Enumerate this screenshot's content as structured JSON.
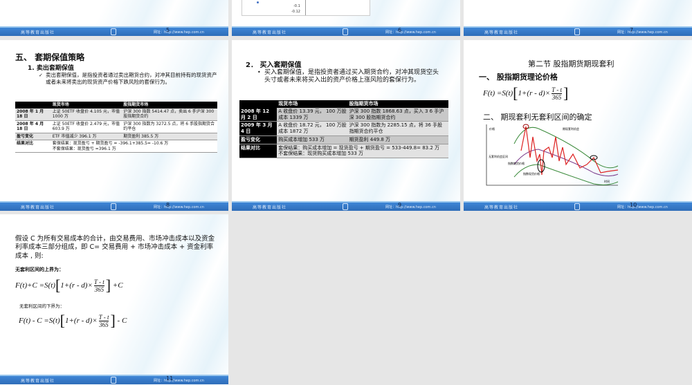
{
  "footer": {
    "publisher": "高等教育出版社",
    "url": "网址：http://www.hep.com.cn"
  },
  "slides": [
    {
      "number": "5"
    },
    {
      "number": "6",
      "chart_ticks": [
        "-0.1",
        "-0.12"
      ]
    },
    {
      "number": "7"
    },
    {
      "number": "8",
      "heading": "五、 套期保值策略",
      "subheading": "1.  卖出套期保值",
      "bullet": "卖出套期保值，是指投资者通过卖出期货合约，对冲其目前持有的现货资产或者未来将卖出的现货资产价格下跌风险的套保行为。",
      "table": {
        "headers": [
          "",
          "现货市场",
          "股指期货市场"
        ],
        "rows": [
          [
            "2008 年 1 月 18 日",
            "上证 50ETF 收盘价 4.105 元，市值 1000 万",
            "沪深 300 指数 5414.47 点，卖出 6 手沪深 300 股指期货合约"
          ],
          [
            "2008 年 4 月 18 日",
            "上证 50ETF 收盘价 2.479 元，市值 603.9 万",
            "沪深 300 指数为 3272.5 点，将 6 手股指期货合约平仓"
          ],
          [
            "盈亏变化",
            "ETF 市值减少 396.1 万",
            "期货盈利 385.5 万"
          ],
          [
            "结果对比",
            "套保结果：现货盈亏 + 期货盈亏 = -396.1+385.5= -10.6 万\n不套保结果：现货盈亏 =396.1 万",
            ""
          ]
        ]
      }
    },
    {
      "number": "9",
      "heading": "2．  买入套期保值",
      "bullet": "买入套期保值，是指投资者通过买入期货合约，对冲其现货空头头寸或者未来将买入出的资产价格上涨风险的套保行为。",
      "table": {
        "headers": [
          "",
          "现货市场",
          "股指期货市场"
        ],
        "rows": [
          [
            "2008 年 12 月 2 日",
            "A 收盘价 13.39 元， 100 万股成本 1339 万",
            "沪深 300 指数 1868.63 点，买入 3 6 手沪深 300 股指期货合约"
          ],
          [
            "2009 年 3 月 4 日",
            "A 收盘价 18.72 元， 100 万股成本 1872 万",
            "沪深 300 指数为 2285.15 点，将 36 手股指期货合约平仓"
          ],
          [
            "盈亏变化",
            "购买成本增加 533 万",
            "期货盈利 449.8 万"
          ],
          [
            "结果对比",
            "套保结果：购买成本增加 = 现货盈亏 + 期货盈亏 = 533-449.8= 83.2 万\n不套保结果：现货购买成本增加 533 万",
            ""
          ]
        ]
      }
    },
    {
      "number": "10",
      "title": "第二节  股指期货期现套利",
      "heading1": "一、 股指期货理论价格",
      "heading2": "二、 期现套利无套利区间的确定",
      "figure_labels": {
        "y": "价格",
        "x": "时间",
        "band": "无套利机会区间",
        "opportunity": "期现套利机会",
        "futures": "指数期货价格",
        "spot": "指数现货价格"
      }
    },
    {
      "number": "11",
      "paragraph": "假设 C 为所有交易成本的合计，由交易费用、市场冲击成本以及资金利率成本三部分组成，即 C= 交易费用 + 市场冲击成本 + 资金利率成本 , 则:",
      "upper_label": "无套利区间的上界为：",
      "lower_label": "无套利区间的下界为："
    }
  ],
  "formula": {
    "lhs": "F(t)",
    "rhs": "=S(t)",
    "inner": "1+(r - d)×",
    "num": "T - t",
    "den": "365",
    "upper_lhs": "F(t)+C",
    "upper_tail": "+C",
    "lower_lhs": "F(t) - C",
    "lower_tail": "- C"
  }
}
